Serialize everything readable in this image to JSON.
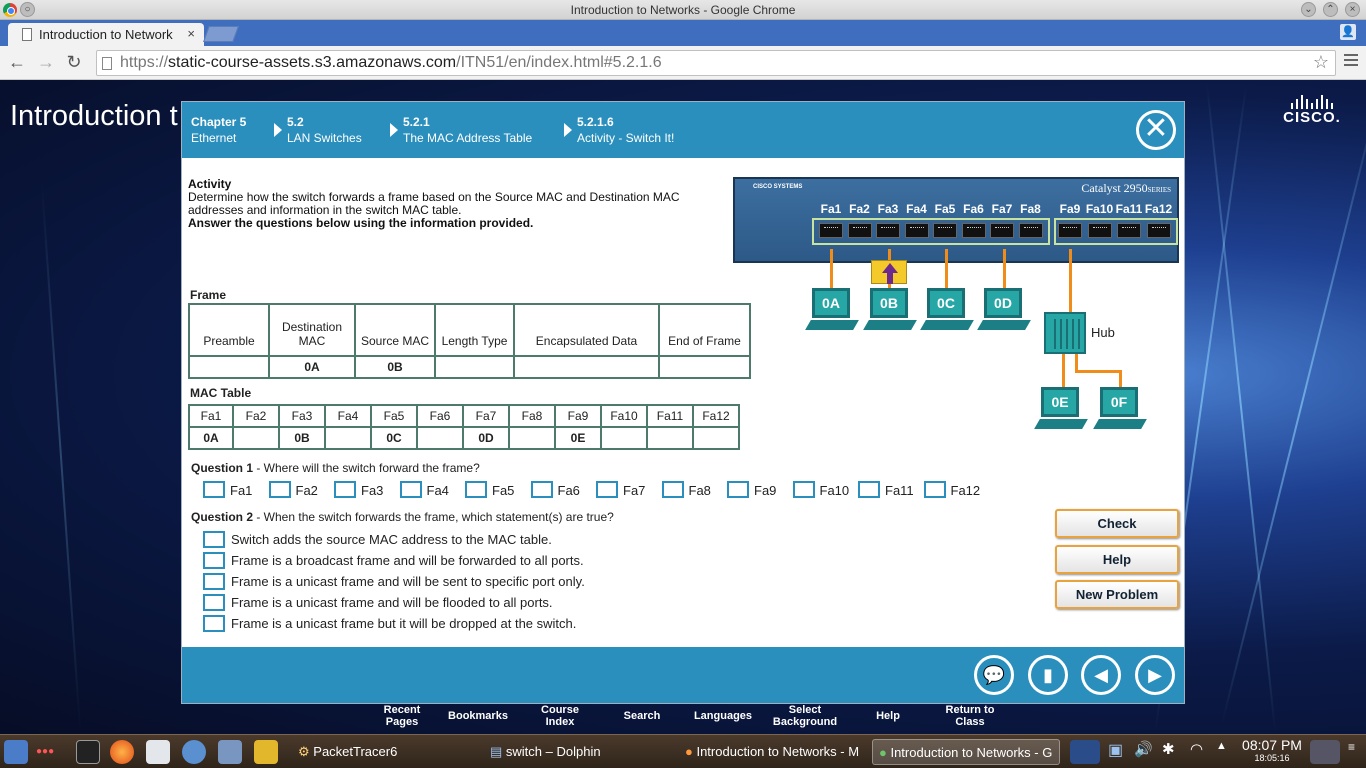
{
  "window": {
    "title": "Introduction to Networks - Google Chrome"
  },
  "tab": {
    "label": "Introduction to Network",
    "close": "×"
  },
  "address": {
    "scheme": "https://",
    "host": "static-course-assets.s3.amazonaws.com",
    "path": "/ITN51/en/index.html#5.2.1.6"
  },
  "page": {
    "bg_title": "Introduction t",
    "cisco_word": "CISCO."
  },
  "breadcrumb": [
    {
      "num": "Chapter 5",
      "label": "Ethernet"
    },
    {
      "num": "5.2",
      "label": "LAN Switches"
    },
    {
      "num": "5.2.1",
      "label": "The MAC Address Table"
    },
    {
      "num": "5.2.1.6",
      "label": "Activity - Switch It!"
    }
  ],
  "activity": {
    "heading": "Activity",
    "description": "Determine how the switch forwards a frame based on the Source MAC and Destination MAC addresses and information in the switch MAC table.",
    "instruction": "Answer the questions below using the information provided."
  },
  "frame": {
    "label": "Frame",
    "headers": [
      "Preamble",
      "Destination MAC",
      "Source MAC",
      "Length Type",
      "Encapsulated Data",
      "End of Frame"
    ],
    "values": [
      "",
      "0A",
      "0B",
      "",
      "",
      ""
    ]
  },
  "mac_table": {
    "label": "MAC Table",
    "ports": [
      "Fa1",
      "Fa2",
      "Fa3",
      "Fa4",
      "Fa5",
      "Fa6",
      "Fa7",
      "Fa8",
      "Fa9",
      "Fa10",
      "Fa11",
      "Fa12"
    ],
    "values": [
      "0A",
      "",
      "0B",
      "",
      "0C",
      "",
      "0D",
      "",
      "0E",
      "",
      "",
      ""
    ]
  },
  "q1": {
    "num": "Question 1",
    "text": " - Where will the switch forward the frame?",
    "options": [
      "Fa1",
      "Fa2",
      "Fa3",
      "Fa4",
      "Fa5",
      "Fa6",
      "Fa7",
      "Fa8",
      "Fa9",
      "Fa10",
      "Fa11",
      "Fa12"
    ]
  },
  "q2": {
    "num": "Question 2",
    "text": " - When the switch forwards the frame, which statement(s) are true?",
    "options": [
      "Switch adds the source MAC address to the MAC table.",
      "Frame is a broadcast frame and will be forwarded to all ports.",
      "Frame is a unicast frame and will be sent to specific port only.",
      "Frame is a unicast frame and will be flooded to all ports.",
      "Frame is a unicast frame but it will be dropped at the switch."
    ]
  },
  "buttons": {
    "check": "Check",
    "help": "Help",
    "new_problem": "New Problem"
  },
  "diagram": {
    "brand": "CISCO SYSTEMS",
    "model": "Catalyst 2950",
    "series": "SERIES",
    "hosts": [
      "0A",
      "0B",
      "0C",
      "0D",
      "0E",
      "0F"
    ],
    "hub_label": "Hub",
    "link_color": "#f08c1a"
  },
  "course_menu": [
    "Recent Pages",
    "Bookmarks",
    "Course Index",
    "Search",
    "Languages",
    "Select Background",
    "Help",
    "Return to Class"
  ],
  "taskbar": {
    "items": [
      "PacketTracer6",
      "switch – Dolphin",
      "Introduction to Networks - M",
      "Introduction to Networks - G"
    ],
    "time": "08:07 PM",
    "date": "18:05:16"
  },
  "colors": {
    "accent": "#2a8fbd",
    "button_border": "#e8a33e",
    "table_border": "#4d7a6a"
  }
}
